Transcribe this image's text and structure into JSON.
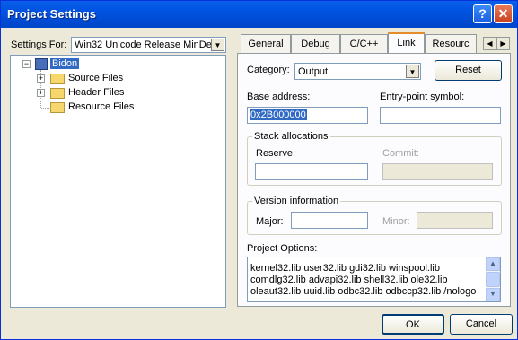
{
  "window": {
    "title": "Project Settings",
    "help_label": "?",
    "close_label": "✕"
  },
  "settings_for": {
    "label": "Settings For:",
    "value": "Win32 Unicode Release MinDe"
  },
  "tree": {
    "root": "Bidon",
    "children": [
      "Source Files",
      "Header Files",
      "Resource Files"
    ]
  },
  "tabs": [
    "General",
    "Debug",
    "C/C++",
    "Link",
    "Resourc"
  ],
  "active_tab": "Link",
  "category": {
    "label": "Category:",
    "value": "Output"
  },
  "reset_label": "Reset",
  "base_address": {
    "label": "Base address:",
    "value": "0x2B000000"
  },
  "entry_point": {
    "label": "Entry-point symbol:",
    "value": ""
  },
  "stack": {
    "title": "Stack allocations",
    "reserve_label": "Reserve:",
    "reserve_value": "",
    "commit_label": "Commit:",
    "commit_value": ""
  },
  "version": {
    "title": "Version information",
    "major_label": "Major:",
    "major_value": "",
    "minor_label": "Minor:",
    "minor_value": ""
  },
  "project_options": {
    "label": "Project Options:",
    "lines": [
      "kernel32.lib user32.lib gdi32.lib winspool.lib",
      "comdlg32.lib advapi32.lib shell32.lib ole32.lib",
      "oleaut32.lib uuid.lib odbc32.lib odbccp32.lib /nologo"
    ]
  },
  "ok_label": "OK",
  "cancel_label": "Cancel"
}
